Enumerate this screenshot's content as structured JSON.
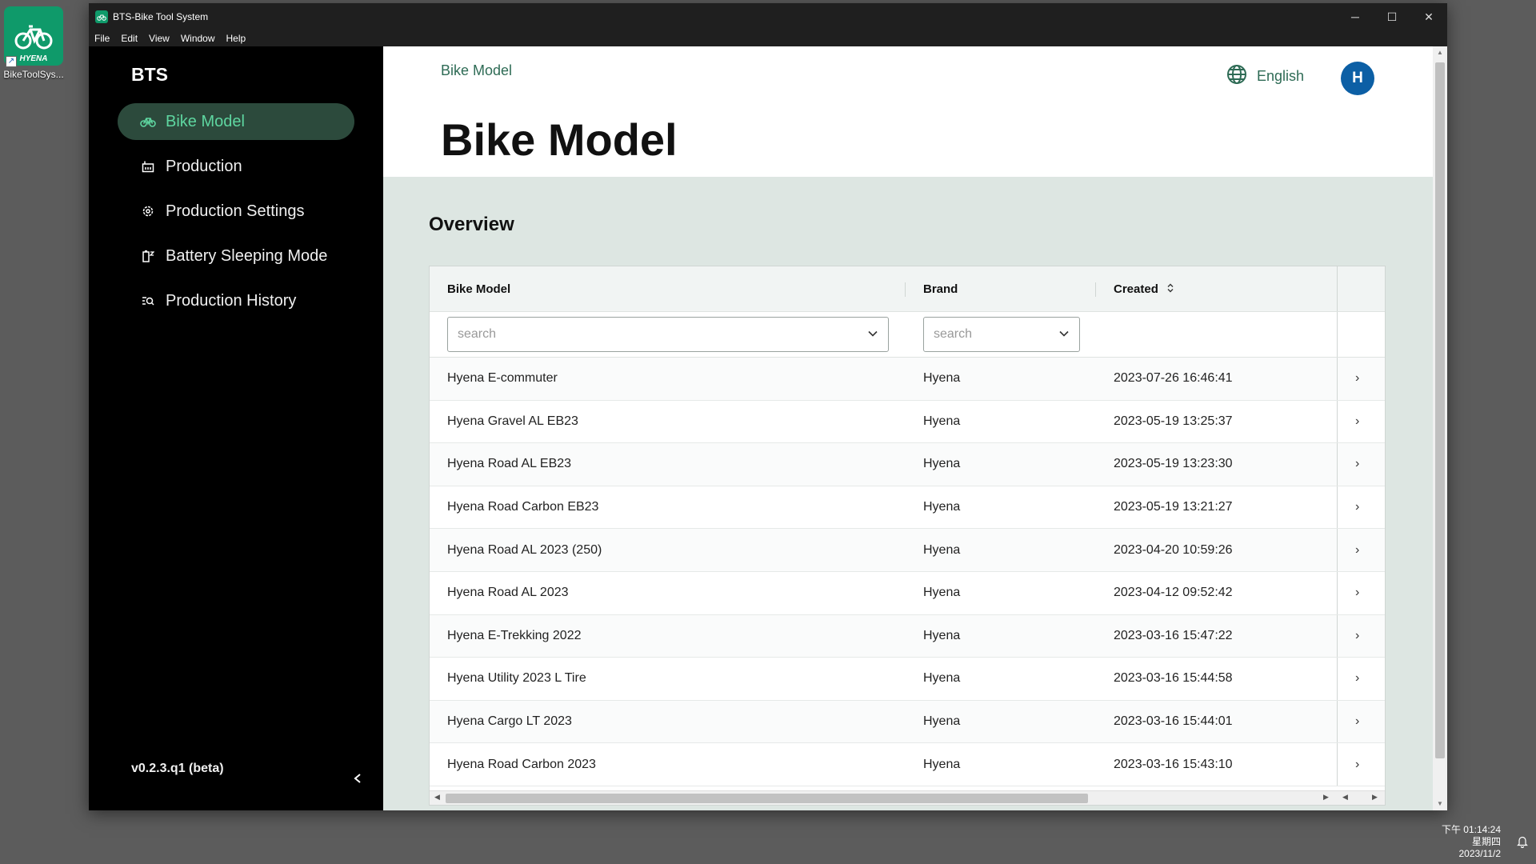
{
  "desktop": {
    "shortcut_label": "BikeToolSys...",
    "icon_brand": "HYENA"
  },
  "window": {
    "title": "BTS-Bike Tool System"
  },
  "menu": [
    "File",
    "Edit",
    "View",
    "Window",
    "Help"
  ],
  "sidebar": {
    "brand": "BTS",
    "items": [
      {
        "label": "Bike Model",
        "icon": "bike-icon",
        "active": true
      },
      {
        "label": "Production",
        "icon": "factory-icon"
      },
      {
        "label": "Production Settings",
        "icon": "gear-icon"
      },
      {
        "label": "Battery Sleeping Mode",
        "icon": "battery-icon"
      },
      {
        "label": "Production History",
        "icon": "history-icon"
      }
    ],
    "version": "v0.2.3.q1 (beta)"
  },
  "header": {
    "breadcrumb": "Bike Model",
    "title": "Bike Model",
    "language": "English",
    "avatar_initial": "H"
  },
  "section_title": "Overview",
  "table": {
    "columns": [
      "Bike Model",
      "Brand",
      "Created"
    ],
    "filters": {
      "model_placeholder": "search",
      "brand_placeholder": "search"
    },
    "rows": [
      {
        "model": "Hyena E-commuter",
        "brand": "Hyena",
        "created": "2023-07-26 16:46:41"
      },
      {
        "model": "Hyena Gravel AL EB23",
        "brand": "Hyena",
        "created": "2023-05-19 13:25:37"
      },
      {
        "model": "Hyena Road AL EB23",
        "brand": "Hyena",
        "created": "2023-05-19 13:23:30"
      },
      {
        "model": "Hyena Road Carbon EB23",
        "brand": "Hyena",
        "created": "2023-05-19 13:21:27"
      },
      {
        "model": "Hyena Road AL 2023 (250)",
        "brand": "Hyena",
        "created": "2023-04-20 10:59:26"
      },
      {
        "model": "Hyena Road AL 2023",
        "brand": "Hyena",
        "created": "2023-04-12 09:52:42"
      },
      {
        "model": "Hyena E-Trekking 2022",
        "brand": "Hyena",
        "created": "2023-03-16 15:47:22"
      },
      {
        "model": "Hyena Utility 2023 L Tire",
        "brand": "Hyena",
        "created": "2023-03-16 15:44:58"
      },
      {
        "model": "Hyena Cargo LT 2023",
        "brand": "Hyena",
        "created": "2023-03-16 15:44:01"
      },
      {
        "model": "Hyena Road Carbon 2023",
        "brand": "Hyena",
        "created": "2023-03-16 15:43:10"
      }
    ]
  },
  "tray": {
    "time": "下午 01:14:24",
    "weekday": "星期四",
    "date": "2023/11/2"
  }
}
